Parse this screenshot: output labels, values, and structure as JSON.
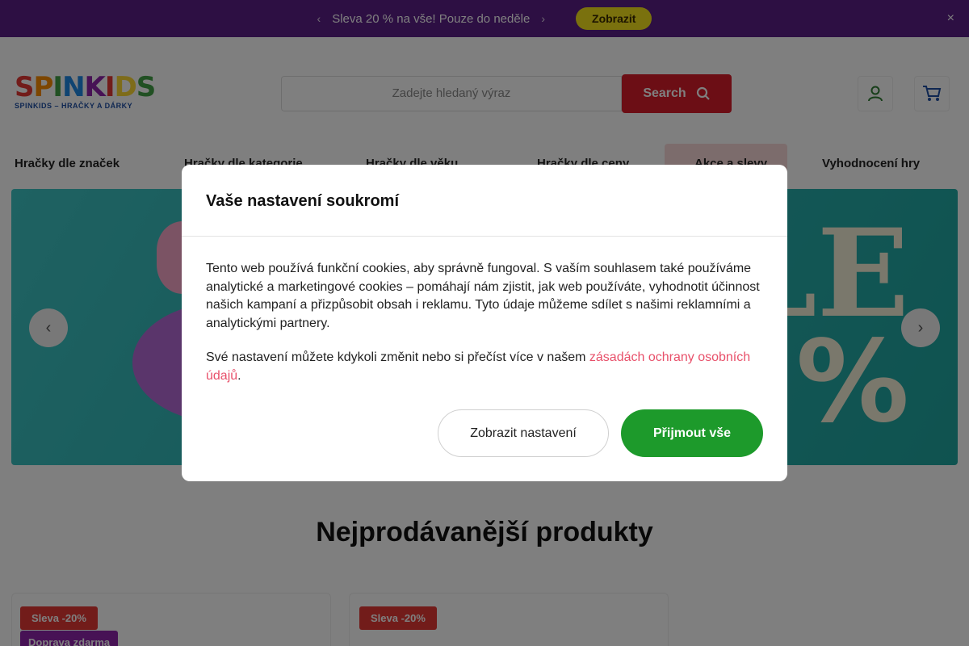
{
  "promo": {
    "text": "Sleva 20 % na vše! Pouze do neděle",
    "button": "Zobrazit",
    "close": "×"
  },
  "header": {
    "logo_word": [
      "S",
      "P",
      "I",
      "N",
      "K",
      "I",
      "D",
      "S"
    ],
    "logo_tagline": "SPINKIDS – HRAČKY A DÁRKY",
    "search_placeholder": "Zadejte hledaný výraz",
    "search_button": "Search"
  },
  "nav": {
    "items": [
      "Hračky dle značek",
      "Hračky dle kategorie",
      "Hračky dle věku",
      "Hračky dle ceny",
      "Akce a slevy",
      "Vyhodnocení hry"
    ]
  },
  "hero": {
    "big_text": "LE",
    "pct_text": "%"
  },
  "section": {
    "title": "Nejprodávanější produkty",
    "card1_badge": "Sleva -20%",
    "card1_badge2": "Doprava zdarma",
    "card2_badge": "Sleva -20%"
  },
  "modal": {
    "title": "Vaše nastavení soukromí",
    "paragraph1": "Tento web používá funkční cookies, aby správně fungoval. S vaším souhlasem také používáme analytické a marketingové cookies – pomáhají nám zjistit, jak web používáte, vyhodnotit účinnost našich kampaní a přizpůsobit obsah i reklamu. Tyto údaje můžeme sdílet s našimi reklamními a analytickými partnery.",
    "paragraph2_prefix": "Své nastavení můžete kdykoli změnit nebo si přečíst více v našem ",
    "paragraph2_link": "zásadách ochrany osobních údajů",
    "paragraph2_suffix": ".",
    "settings_button": "Zobrazit nastavení",
    "accept_button": "Přijmout vše"
  },
  "colors": {
    "promo_bg": "#5a1f86",
    "accent_red": "#d91d2a",
    "accept_green": "#1d9a2b",
    "link_pink": "#e8506a"
  }
}
